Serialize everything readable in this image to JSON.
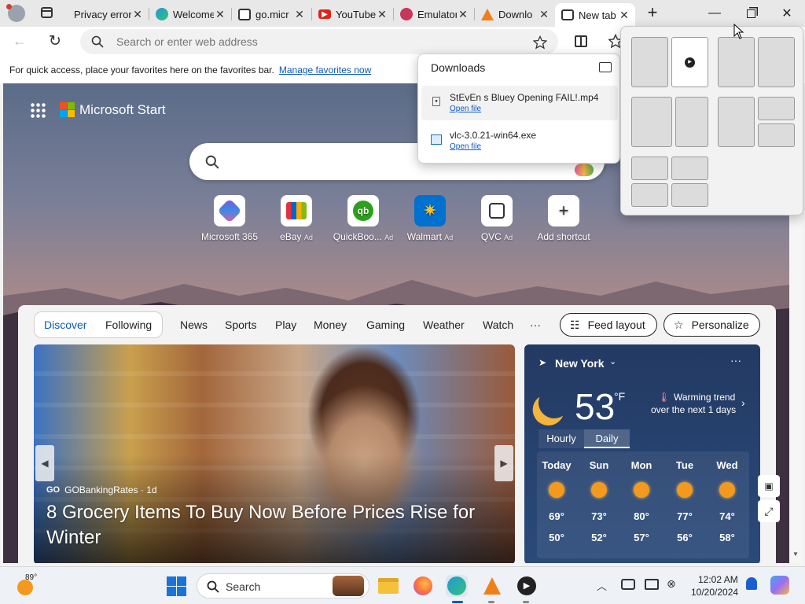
{
  "tabs": [
    {
      "title": "Privacy error",
      "favicon": "lock-warning-icon",
      "active": false
    },
    {
      "title": "Welcome",
      "favicon": "edge-icon",
      "active": false
    },
    {
      "title": "go.micr",
      "favicon": "document-icon",
      "active": false
    },
    {
      "title": "YouTube",
      "favicon": "youtube-icon",
      "active": false
    },
    {
      "title": "Emulator",
      "favicon": "emulator-icon",
      "active": false
    },
    {
      "title": "Downlo",
      "favicon": "vlc-icon",
      "active": false
    },
    {
      "title": "New tab",
      "favicon": "newtab-icon",
      "active": true
    }
  ],
  "toolbar": {
    "address_placeholder": "Search or enter web address"
  },
  "favorites_bar": {
    "message": "For quick access, place your favorites here on the favorites bar.",
    "link": "Manage favorites now"
  },
  "downloads": {
    "title": "Downloads",
    "items": [
      {
        "name": "StEvEn s Bluey Opening FAIL!.mp4",
        "action": "Open file"
      },
      {
        "name": "vlc-3.0.21-win64.exe",
        "action": "Open file"
      }
    ]
  },
  "page": {
    "brand": "Microsoft Start",
    "quick_links": [
      {
        "label": "Microsoft 365",
        "ad": ""
      },
      {
        "label": "eBay",
        "ad": "Ad"
      },
      {
        "label": "QuickBoo...",
        "ad": "Ad"
      },
      {
        "label": "Walmart",
        "ad": "Ad"
      },
      {
        "label": "QVC",
        "ad": "Ad"
      },
      {
        "label": "Add shortcut",
        "ad": ""
      }
    ],
    "feed_nav": {
      "discover": "Discover",
      "following": "Following",
      "items": [
        "News",
        "Sports",
        "Play",
        "Money",
        "Gaming",
        "Weather",
        "Watch"
      ],
      "more": "···",
      "feed_layout": "Feed layout",
      "personalize": "Personalize"
    },
    "hero": {
      "source": "GOBankingRates",
      "source_badge": "GO",
      "age": "· 1d",
      "headline": "8 Grocery Items To Buy Now Before Prices Rise for Winter"
    },
    "weather": {
      "location": "New York",
      "temp": "53",
      "unit": "°F",
      "trend_line1": "Warming trend",
      "trend_line2": "over the next 1 days",
      "tab_hourly": "Hourly",
      "tab_daily": "Daily",
      "days": [
        {
          "name": "Today",
          "hi": "69°",
          "lo": "50°"
        },
        {
          "name": "Sun",
          "hi": "73°",
          "lo": "52°"
        },
        {
          "name": "Mon",
          "hi": "80°",
          "lo": "57°"
        },
        {
          "name": "Tue",
          "hi": "77°",
          "lo": "56°"
        },
        {
          "name": "Wed",
          "hi": "74°",
          "lo": "58°"
        }
      ]
    }
  },
  "taskbar": {
    "weather_temp": "89°",
    "search_label": "Search",
    "time": "12:02 AM",
    "date": "10/20/2024"
  },
  "colors": {
    "accent": "#0a59c9",
    "taskbar_bg": "#eef1f5",
    "weather_bg": "#233a63"
  }
}
